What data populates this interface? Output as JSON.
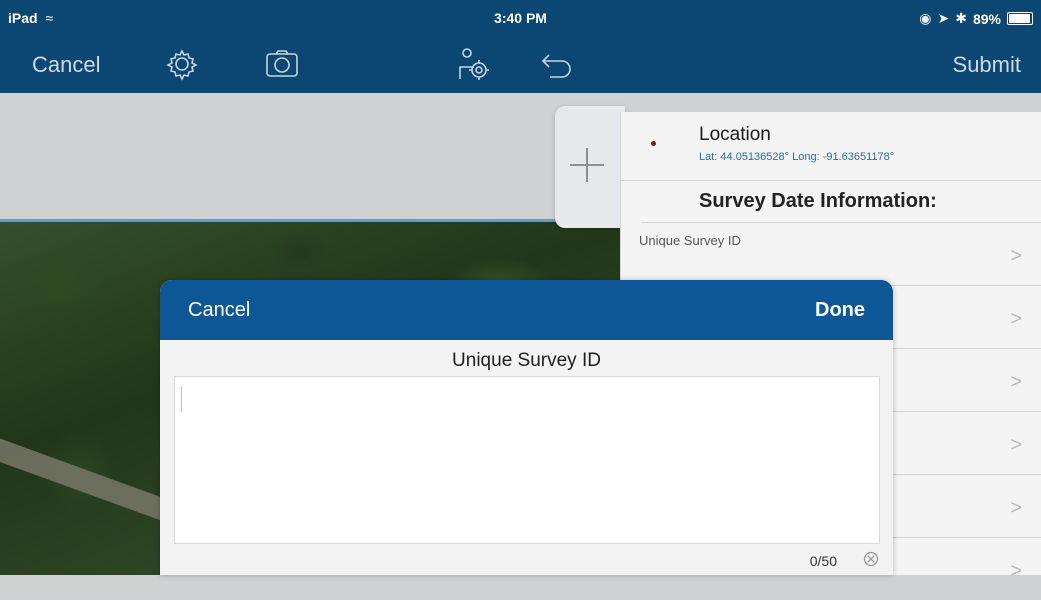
{
  "status_bar": {
    "device": "iPad",
    "time": "3:40 PM",
    "battery": "89%",
    "battery_level": 0.89
  },
  "toolbar": {
    "cancel_label": "Cancel",
    "submit_label": "Submit",
    "icons": [
      "gear-icon",
      "camera-icon",
      "person-target-icon",
      "undo-icon"
    ]
  },
  "form": {
    "location": {
      "title": "Location",
      "coords": "Lat: 44.05136528° Long: -91.63651178°"
    },
    "section_title": "Survey Date Information:",
    "first_field_label": "Unique Survey ID",
    "chevron": ">"
  },
  "dialog": {
    "cancel_label": "Cancel",
    "done_label": "Done",
    "title": "Unique Survey ID",
    "input_value": "",
    "counter": "0/50"
  },
  "colors": {
    "bar": "#0c4672",
    "dialog_header": "#0d5796",
    "accent_text": "#2a6aa3"
  }
}
